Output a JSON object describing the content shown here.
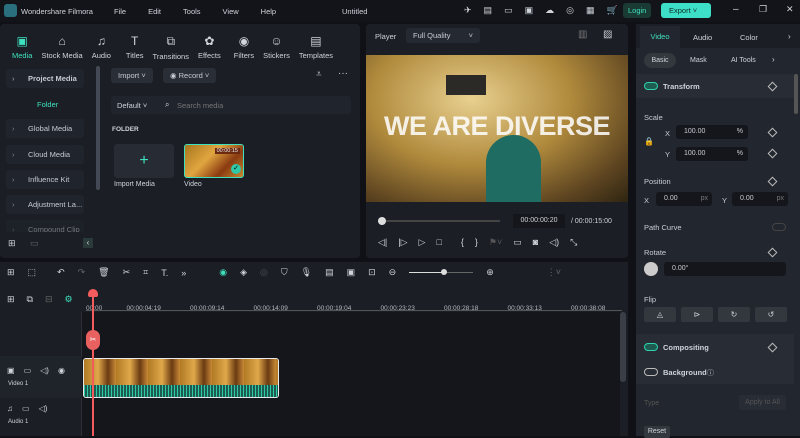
{
  "app": {
    "title": "Wondershare Filmora",
    "doc_title": "Untitled",
    "menu": [
      "File",
      "Edit",
      "Tools",
      "View",
      "Help"
    ],
    "login": "Login",
    "export": "Export"
  },
  "toolbar": [
    {
      "label": "Media",
      "icon": "media-icon"
    },
    {
      "label": "Stock Media",
      "icon": "stock-icon"
    },
    {
      "label": "Audio",
      "icon": "audio-icon"
    },
    {
      "label": "Titles",
      "icon": "titles-icon"
    },
    {
      "label": "Transitions",
      "icon": "transitions-icon"
    },
    {
      "label": "Effects",
      "icon": "effects-icon"
    },
    {
      "label": "Filters",
      "icon": "filters-icon"
    },
    {
      "label": "Stickers",
      "icon": "stickers-icon"
    },
    {
      "label": "Templates",
      "icon": "templates-icon"
    }
  ],
  "sidebar": {
    "items": [
      "Project Media",
      "Folder",
      "Global Media",
      "Cloud Media",
      "Influence Kit",
      "Adjustment La...",
      "Compound Clip"
    ]
  },
  "media": {
    "import": "Import",
    "record": "Record",
    "sort": "Default",
    "search_placeholder": "Search media",
    "folder": "FOLDER",
    "import_media": "Import Media",
    "clip_name": "Video",
    "clip_duration": "00:00:15"
  },
  "player": {
    "label": "Player",
    "quality": "Full Quality",
    "overlay_text": "WE ARE DIVERSE",
    "current": "00:00:00:20",
    "total": "/ 00:00:15:00",
    "progress": 0.02
  },
  "props": {
    "tabs": [
      "Video",
      "Audio",
      "Color"
    ],
    "subtabs": [
      "Basic",
      "Mask",
      "AI Tools"
    ],
    "transform": "Transform",
    "scale": "Scale",
    "scale_x": "100.00",
    "scale_y": "100.00",
    "pct": "%",
    "position": "Position",
    "pos_x": "0.00",
    "pos_y": "0.00",
    "px": "px",
    "path_curve": "Path Curve",
    "rotate": "Rotate",
    "rotate_val": "0.00°",
    "flip": "Flip",
    "compositing": "Compositing",
    "background": "Background",
    "type": "Type",
    "apply_all": "Apply to All",
    "reset": "Reset",
    "x": "X",
    "y": "Y"
  },
  "timeline": {
    "ticks": [
      "00:00",
      "00:00:04:19",
      "00:00:09:14",
      "00:00:14:09",
      "00:00:19:04",
      "00:00:23:23",
      "00:00:28:18",
      "00:00:33:13",
      "00:00:38:08"
    ],
    "video_track": "Video 1",
    "audio_track": "Audio 1",
    "zoom": 0.55
  }
}
